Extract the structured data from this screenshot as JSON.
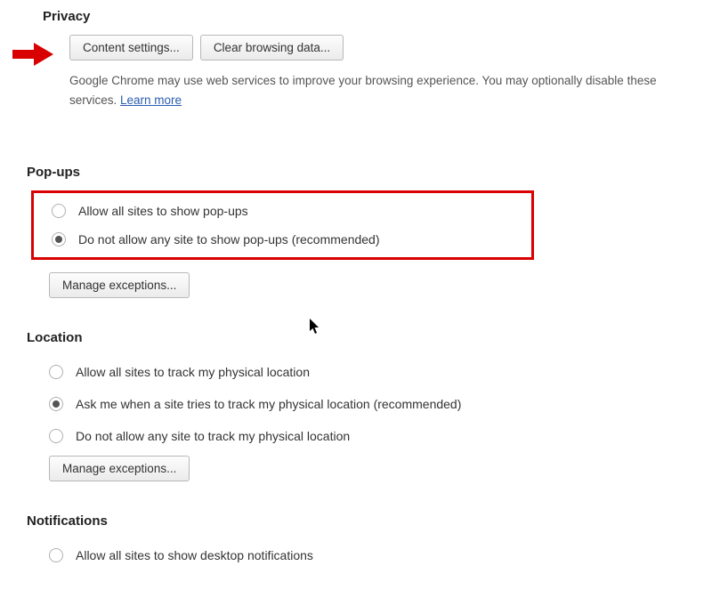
{
  "privacy": {
    "title": "Privacy",
    "content_settings_btn": "Content settings...",
    "clear_data_btn": "Clear browsing data...",
    "description_text": "Google Chrome may use web services to improve your browsing experience. You may optionally disable these services. ",
    "learn_more": "Learn more"
  },
  "popups": {
    "title": "Pop-ups",
    "option_allow": "Allow all sites to show pop-ups",
    "option_block": "Do not allow any site to show pop-ups (recommended)",
    "selected": "block",
    "manage_exceptions": "Manage exceptions..."
  },
  "location": {
    "title": "Location",
    "option_allow": "Allow all sites to track my physical location",
    "option_ask": "Ask me when a site tries to track my physical location (recommended)",
    "option_block": "Do not allow any site to track my physical location",
    "selected": "ask",
    "manage_exceptions": "Manage exceptions..."
  },
  "notifications": {
    "title": "Notifications",
    "option_allow": "Allow all sites to show desktop notifications"
  }
}
